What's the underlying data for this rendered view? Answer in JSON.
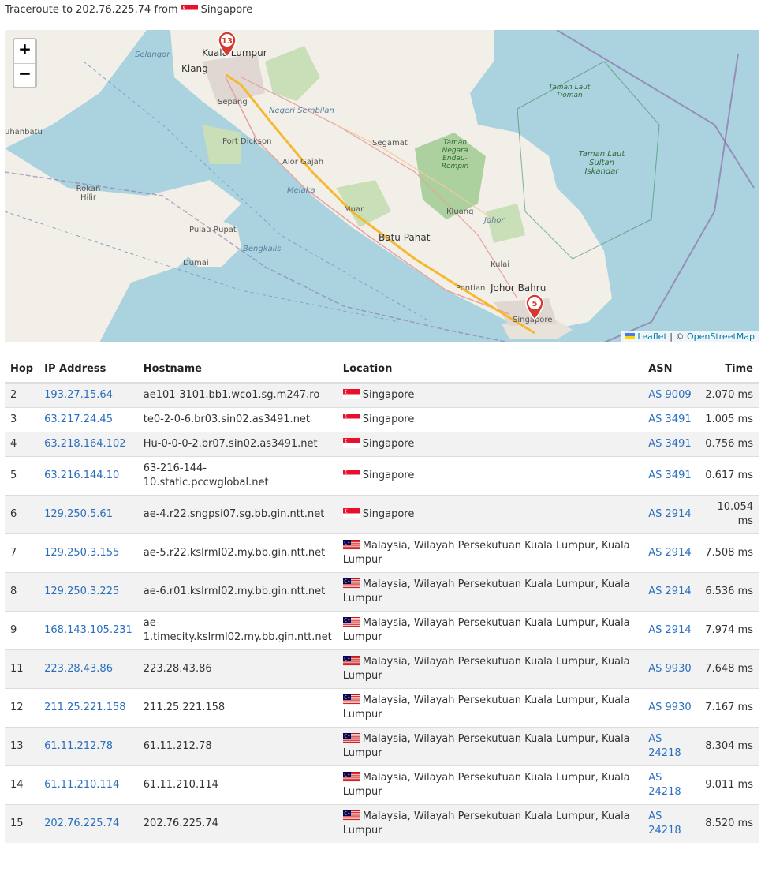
{
  "header": {
    "prefix": "Traceroute to 202.76.225.74 from",
    "origin": "Singapore"
  },
  "map": {
    "zoom_in": "+",
    "zoom_out": "−",
    "attribution_leaflet": "Leaflet",
    "attribution_sep": "| ©",
    "attribution_osm": "OpenStreetMap",
    "markers": [
      {
        "label": "13",
        "place": "Kuala Lumpur"
      },
      {
        "label": "5",
        "place": "Singapore"
      }
    ],
    "labels": {
      "kuala_lumpur": "Kuala Lumpur",
      "klang": "Klang",
      "selangor": "Selangor",
      "sepang": "Sepang",
      "negeri_sembilan": "Negeri Sembilan",
      "port_dickson": "Port Dickson",
      "segamat": "Segamat",
      "alor_gajah": "Alor Gajah",
      "melaka": "Melaka",
      "muar": "Muar",
      "batu_pahat": "Batu Pahat",
      "kluang": "Kluang",
      "johor": "Johor",
      "kulai": "Kulai",
      "johor_bahru": "Johor Bahru",
      "pontian": "Pontian",
      "singapore": "Singapore",
      "pulau_rupat": "Pulau Rupat",
      "dumai": "Dumai",
      "bengkalis": "Bengkalis",
      "rokan_hilir": "Rokan Hilir",
      "labuhanbatu": "uhanbatu",
      "taman_negara": "Taman Negara Endau-Rompin",
      "taman_laut_tioman": "Taman Laut Tioman",
      "taman_laut_sultan": "Taman Laut Sultan Iskandar"
    }
  },
  "table": {
    "headers": {
      "hop": "Hop",
      "ip": "IP Address",
      "hostname": "Hostname",
      "location": "Location",
      "asn": "ASN",
      "time": "Time"
    },
    "rows": [
      {
        "hop": "2",
        "ip": "193.27.15.64",
        "hostname": "ae101-3101.bb1.wco1.sg.m247.ro",
        "country": "sg",
        "location": "Singapore",
        "asn": "AS 9009",
        "time": "2.070 ms"
      },
      {
        "hop": "3",
        "ip": "63.217.24.45",
        "hostname": "te0-2-0-6.br03.sin02.as3491.net",
        "country": "sg",
        "location": "Singapore",
        "asn": "AS 3491",
        "time": "1.005 ms"
      },
      {
        "hop": "4",
        "ip": "63.218.164.102",
        "hostname": "Hu-0-0-0-2.br07.sin02.as3491.net",
        "country": "sg",
        "location": "Singapore",
        "asn": "AS 3491",
        "time": "0.756 ms"
      },
      {
        "hop": "5",
        "ip": "63.216.144.10",
        "hostname": "63-216-144-10.static.pccwglobal.net",
        "country": "sg",
        "location": "Singapore",
        "asn": "AS 3491",
        "time": "0.617 ms"
      },
      {
        "hop": "6",
        "ip": "129.250.5.61",
        "hostname": "ae-4.r22.sngpsi07.sg.bb.gin.ntt.net",
        "country": "sg",
        "location": "Singapore",
        "asn": "AS 2914",
        "time": "10.054 ms"
      },
      {
        "hop": "7",
        "ip": "129.250.3.155",
        "hostname": "ae-5.r22.kslrml02.my.bb.gin.ntt.net",
        "country": "my",
        "location": "Malaysia, Wilayah Persekutuan Kuala Lumpur, Kuala Lumpur",
        "asn": "AS 2914",
        "time": "7.508 ms"
      },
      {
        "hop": "8",
        "ip": "129.250.3.225",
        "hostname": "ae-6.r01.kslrml02.my.bb.gin.ntt.net",
        "country": "my",
        "location": "Malaysia, Wilayah Persekutuan Kuala Lumpur, Kuala Lumpur",
        "asn": "AS 2914",
        "time": "6.536 ms"
      },
      {
        "hop": "9",
        "ip": "168.143.105.231",
        "hostname": "ae-1.timecity.kslrml02.my.bb.gin.ntt.net",
        "country": "my",
        "location": "Malaysia, Wilayah Persekutuan Kuala Lumpur, Kuala Lumpur",
        "asn": "AS 2914",
        "time": "7.974 ms"
      },
      {
        "hop": "11",
        "ip": "223.28.43.86",
        "hostname": "223.28.43.86",
        "country": "my",
        "location": "Malaysia, Wilayah Persekutuan Kuala Lumpur, Kuala Lumpur",
        "asn": "AS 9930",
        "time": "7.648 ms"
      },
      {
        "hop": "12",
        "ip": "211.25.221.158",
        "hostname": "211.25.221.158",
        "country": "my",
        "location": "Malaysia, Wilayah Persekutuan Kuala Lumpur, Kuala Lumpur",
        "asn": "AS 9930",
        "time": "7.167 ms"
      },
      {
        "hop": "13",
        "ip": "61.11.212.78",
        "hostname": "61.11.212.78",
        "country": "my",
        "location": "Malaysia, Wilayah Persekutuan Kuala Lumpur, Kuala Lumpur",
        "asn": "AS 24218",
        "time": "8.304 ms"
      },
      {
        "hop": "14",
        "ip": "61.11.210.114",
        "hostname": "61.11.210.114",
        "country": "my",
        "location": "Malaysia, Wilayah Persekutuan Kuala Lumpur, Kuala Lumpur",
        "asn": "AS 24218",
        "time": "9.011 ms"
      },
      {
        "hop": "15",
        "ip": "202.76.225.74",
        "hostname": "202.76.225.74",
        "country": "my",
        "location": "Malaysia, Wilayah Persekutuan Kuala Lumpur, Kuala Lumpur",
        "asn": "AS 24218",
        "time": "8.520 ms"
      }
    ]
  },
  "colors": {
    "link": "#2a6fbe",
    "route": "#f5b82e",
    "marker": "#d63a2f",
    "water": "#aad3df",
    "land": "#f2efe9"
  }
}
